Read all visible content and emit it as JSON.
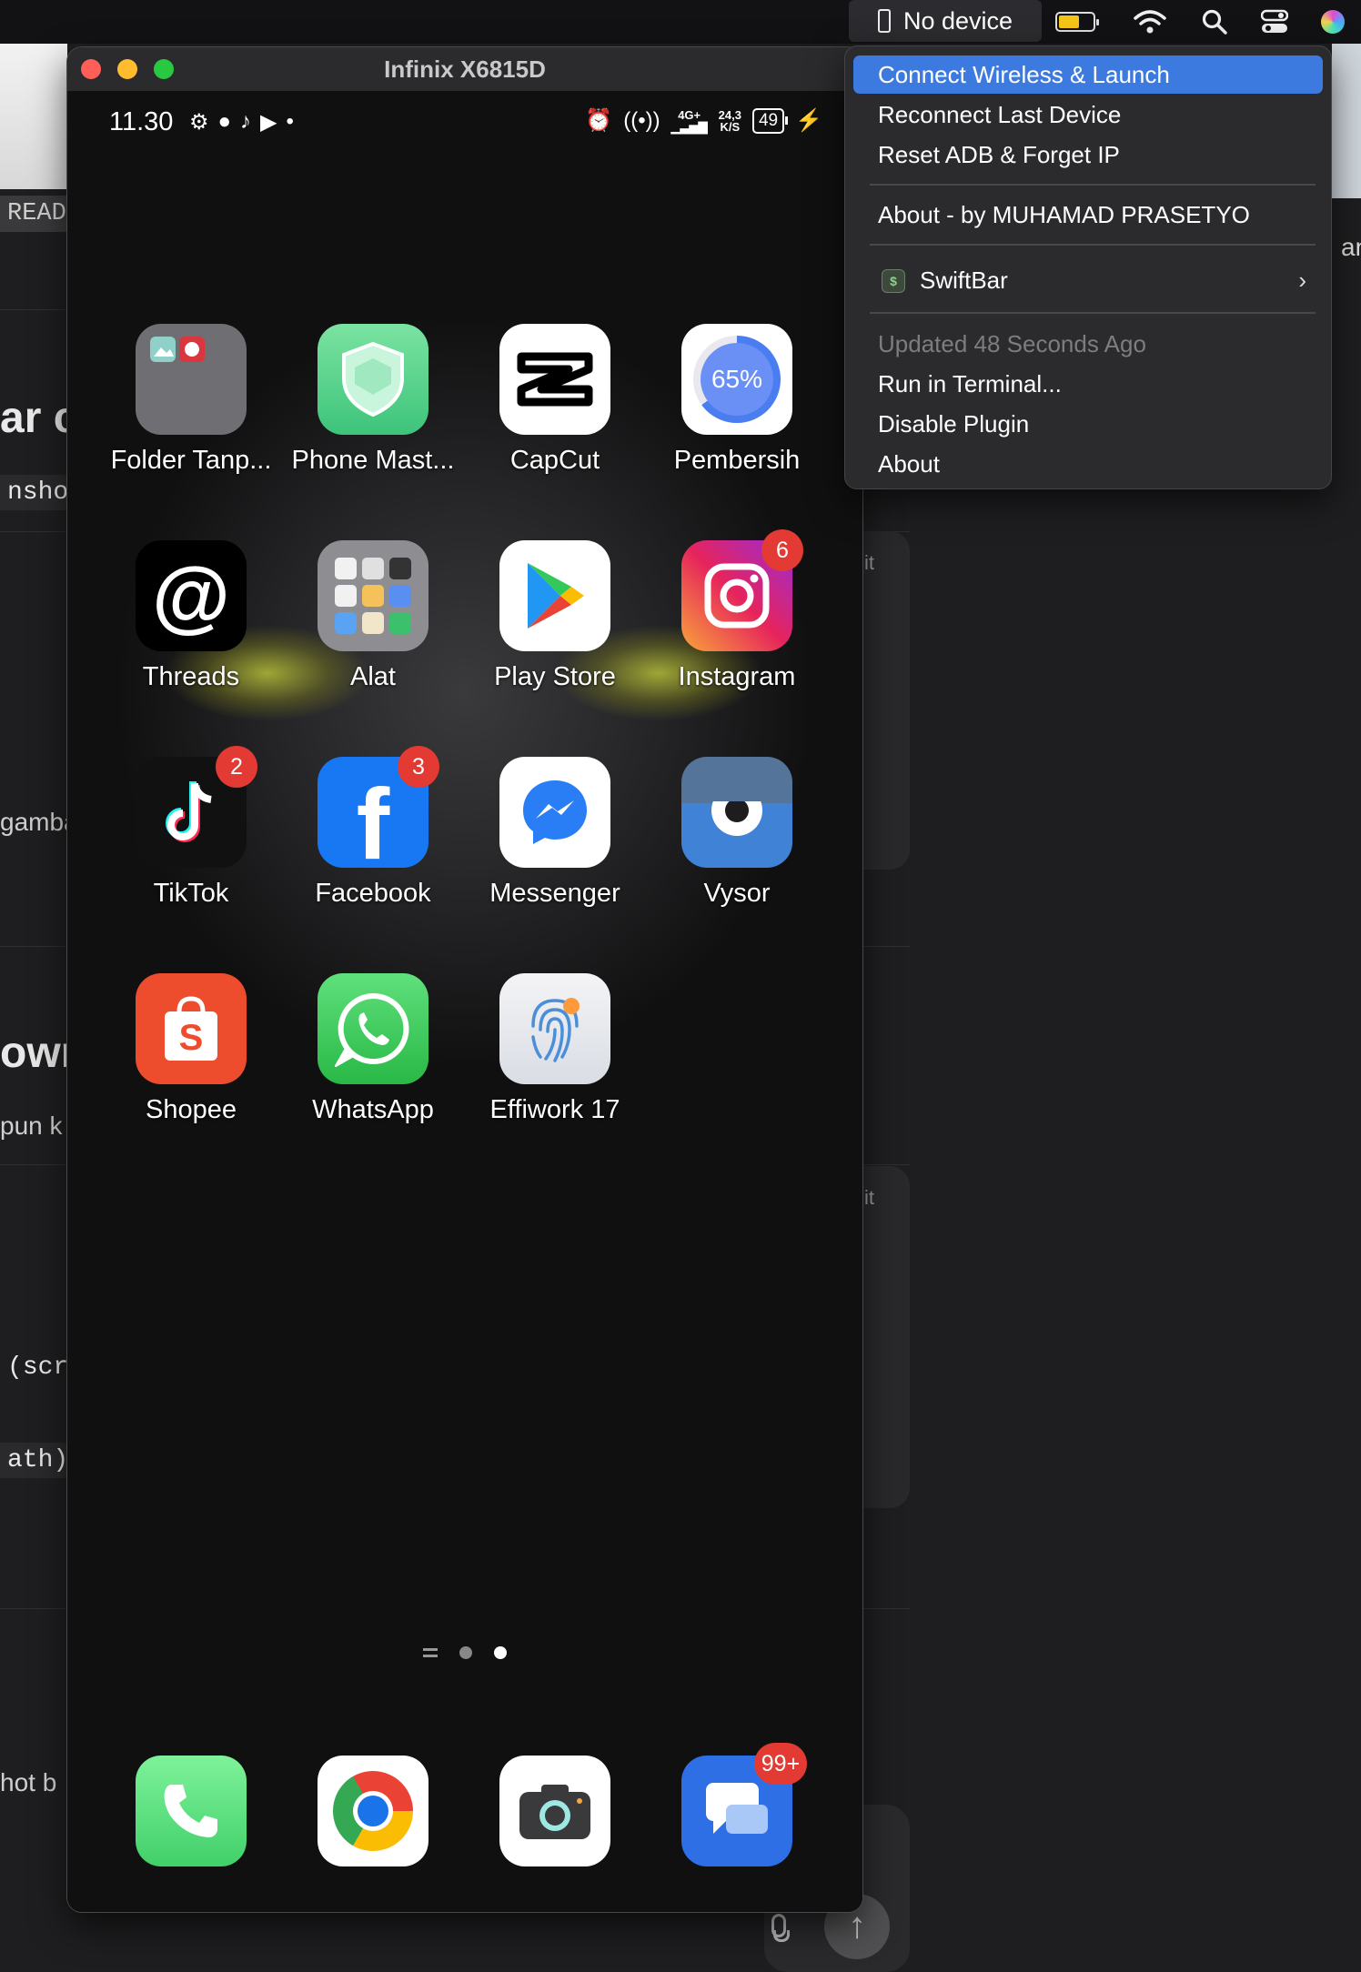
{
  "menubar": {
    "device_label": "No device"
  },
  "menu": {
    "items": [
      {
        "label": "Connect Wireless & Launch"
      },
      {
        "label": "Reconnect Last Device"
      },
      {
        "label": "Reset ADB & Forget IP"
      },
      {
        "label": "About - by MUHAMAD PRASETYO"
      },
      {
        "label": "SwiftBar"
      },
      {
        "label": "Updated 48 Seconds Ago"
      },
      {
        "label": "Run in Terminal..."
      },
      {
        "label": "Disable Plugin"
      },
      {
        "label": "About"
      }
    ]
  },
  "window": {
    "title": "Infinix X6815D"
  },
  "phone": {
    "time": "11.30",
    "network_top": "4G+",
    "speed_value": "24,3",
    "speed_unit": "K/S",
    "battery": "49",
    "apps": [
      {
        "label": "Folder Tanp..."
      },
      {
        "label": "Phone Mast..."
      },
      {
        "label": "CapCut"
      },
      {
        "label": "Pembersih",
        "icon_text": "65%"
      },
      {
        "label": "Threads"
      },
      {
        "label": "Alat"
      },
      {
        "label": "Play Store"
      },
      {
        "label": "Instagram",
        "badge": "6"
      },
      {
        "label": "TikTok",
        "badge": "2"
      },
      {
        "label": "Facebook",
        "badge": "3"
      },
      {
        "label": "Messenger"
      },
      {
        "label": "Vysor"
      },
      {
        "label": "Shopee"
      },
      {
        "label": "WhatsApp"
      },
      {
        "label": "Effiwork 17"
      }
    ],
    "dock_badge": "99+"
  },
  "background": {
    "readme": "READ",
    "frag1": "ar c",
    "frag2": "nshot",
    "frag3": "gamba",
    "frag4": "owr",
    "frag5": "pun k",
    "frag6_paren": "(",
    "frag6_red": "scre",
    "frag7": "ath)",
    "frag8": "hot b",
    "card_label1": "it",
    "card_label2": "it",
    "right_text": "an"
  }
}
